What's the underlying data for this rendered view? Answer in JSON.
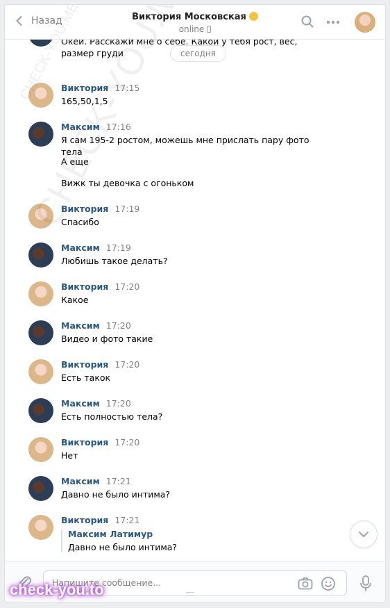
{
  "header": {
    "back_label": "Назад",
    "title": "Виктория Московская",
    "status": "online"
  },
  "date_separator": "сегодня",
  "messages": [
    {
      "sender": "",
      "time": "",
      "text": "Окей. Расскажи мне о себе. Какой у тебя рост, вес, размер груди"
    },
    {
      "sender": "Виктория",
      "time": "17:15",
      "text": "165,50,1,5"
    },
    {
      "sender": "Максим",
      "time": "17:16",
      "text": "Я сам 195-2 ростом, можешь мне прислать пару фото тела"
    },
    {
      "sender": "",
      "time": "",
      "text": "А еще"
    },
    {
      "sender": "",
      "time": "",
      "text": "Вижк ты девочка с огоньком"
    },
    {
      "sender": "Виктория",
      "time": "17:19",
      "text": "Спасибо"
    },
    {
      "sender": "Максим",
      "time": "17:19",
      "text": "Любишь такое делать?"
    },
    {
      "sender": "Виктория",
      "time": "17:20",
      "text": "Какое"
    },
    {
      "sender": "Максим",
      "time": "17:20",
      "text": "Видео и фото такие"
    },
    {
      "sender": "Виктория",
      "time": "17:20",
      "text": "Есть такок"
    },
    {
      "sender": "Максим",
      "time": "17:20",
      "text": "Есть полностью тела?"
    },
    {
      "sender": "Виктория",
      "time": "17:20",
      "text": "Нет"
    },
    {
      "sender": "Максим",
      "time": "17:21",
      "text": "Давно не было интима?"
    },
    {
      "sender": "Виктория",
      "time": "17:21",
      "reply_name": "Максим Латимур",
      "reply_text": "Давно не было интима?"
    }
  ],
  "composer": {
    "placeholder": "Напишите сообщение..."
  },
  "watermarks": {
    "diagonal_small": "CHECK-YOU.ME",
    "diagonal_large": "CHECK-YOU.ME",
    "bottom": "check-you.to"
  },
  "colors": {
    "link": "#2a5885",
    "muted": "#828282",
    "background": "#edeef0"
  }
}
